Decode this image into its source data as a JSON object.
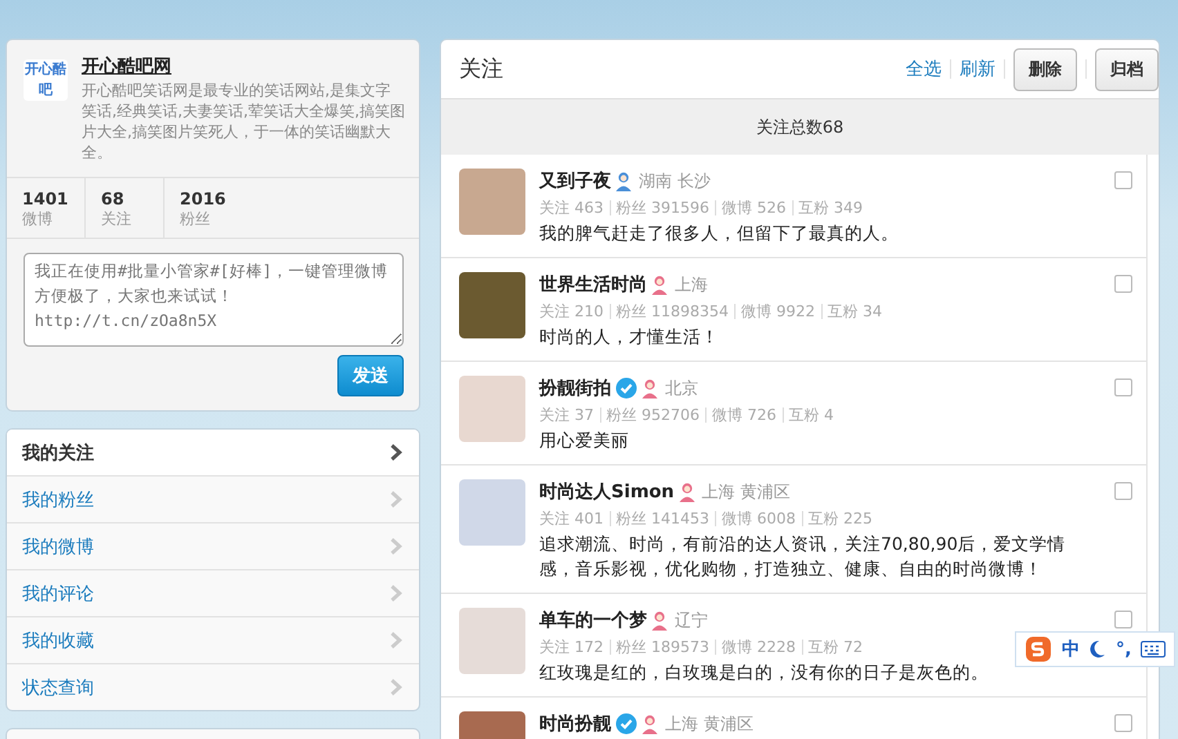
{
  "profile": {
    "name": "开心酷吧网",
    "logo_text": "开心酷吧",
    "description": "开心酷吧笑话网是最专业的笑话网站,是集文字笑话,经典笑话,夫妻笑话,荤笑话大全爆笑,搞笑图片大全,搞笑图片笑死人，于一体的笑话幽默大全。",
    "stats": [
      {
        "value": "1401",
        "label": "微博"
      },
      {
        "value": "68",
        "label": "关注"
      },
      {
        "value": "2016",
        "label": "粉丝"
      }
    ]
  },
  "composer": {
    "placeholder": "我正在使用#批量小管家#[好棒]，一键管理微博方便极了，大家也来试试！http://t.cn/zOa8n5X",
    "send": "发送"
  },
  "nav": [
    {
      "label": "我的关注",
      "selected": true
    },
    {
      "label": "我的粉丝",
      "selected": false
    },
    {
      "label": "我的微博",
      "selected": false
    },
    {
      "label": "我的评论",
      "selected": false
    },
    {
      "label": "我的收藏",
      "selected": false
    },
    {
      "label": "状态查询",
      "selected": false
    }
  ],
  "main": {
    "title": "关注",
    "links": [
      "全选",
      "刷新"
    ],
    "buttons": [
      "删除",
      "归档"
    ],
    "summary": "关注总数68",
    "users": [
      {
        "name": "又到子夜",
        "verified": false,
        "female": false,
        "location": "湖南 长沙",
        "stats": [
          "关注 463",
          "粉丝 391596",
          "微博 526",
          "互粉 349"
        ],
        "bio": "我的脾气赶走了很多人，但留下了最真的人。",
        "checked": false
      },
      {
        "name": "世界生活时尚",
        "verified": false,
        "female": true,
        "location": "上海",
        "stats": [
          "关注 210",
          "粉丝 11898354",
          "微博 9922",
          "互粉 34"
        ],
        "bio": "时尚的人，才懂生活！",
        "checked": false
      },
      {
        "name": "扮靓街拍",
        "verified": true,
        "female": true,
        "location": "北京",
        "stats": [
          "关注 37",
          "粉丝 952706",
          "微博 726",
          "互粉 4"
        ],
        "bio": "用心爱美丽",
        "checked": false
      },
      {
        "name": "时尚达人Simon",
        "verified": false,
        "female": true,
        "location": "上海 黄浦区",
        "stats": [
          "关注 401",
          "粉丝 141453",
          "微博 6008",
          "互粉 225"
        ],
        "bio": "追求潮流、时尚，有前沿的达人资讯，关注70,80,90后，爱文学情感，音乐影视，优化购物，打造独立、健康、自由的时尚微博！",
        "checked": false
      },
      {
        "name": "单车的一个梦",
        "verified": false,
        "female": true,
        "location": "辽宁",
        "stats": [
          "关注 172",
          "粉丝 189573",
          "微博 2228",
          "互粉 72"
        ],
        "bio": "红玫瑰是红的，白玫瑰是白的，没有你的日子是灰色的。",
        "checked": false
      },
      {
        "name": "时尚扮靓",
        "verified": true,
        "female": true,
        "location": "上海 黄浦区",
        "checked": false
      }
    ]
  },
  "ime_toolbar": {
    "mode": "中",
    "punctuation": "°,"
  }
}
